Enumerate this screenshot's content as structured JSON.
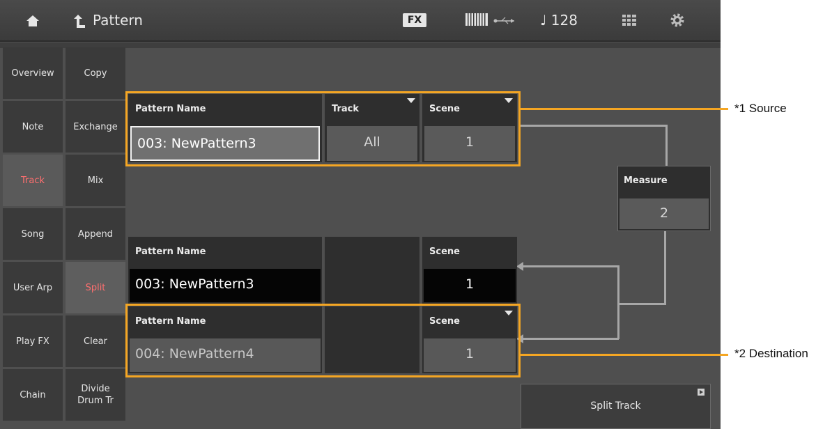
{
  "header": {
    "breadcrumb": "Pattern",
    "fx_label": "FX",
    "tempo": "♩ 128"
  },
  "sidebar": {
    "left": [
      {
        "label": "Overview"
      },
      {
        "label": "Note"
      },
      {
        "label": "Track"
      },
      {
        "label": "Song"
      },
      {
        "label": "User Arp"
      },
      {
        "label": "Play FX"
      },
      {
        "label": "Chain"
      }
    ],
    "right": [
      {
        "label": "Copy"
      },
      {
        "label": "Exchange"
      },
      {
        "label": "Mix"
      },
      {
        "label": "Append"
      },
      {
        "label": "Split"
      },
      {
        "label": "Clear"
      },
      {
        "label": "Divide\nDrum Tr"
      }
    ],
    "selected_left": "Track",
    "selected_right": "Split"
  },
  "source": {
    "pattern_name_header": "Pattern Name",
    "pattern_name_value": "003: NewPattern3",
    "track_header": "Track",
    "track_value": "All",
    "scene_header": "Scene",
    "scene_value": "1"
  },
  "measure": {
    "header": "Measure",
    "value": "2"
  },
  "result": {
    "pattern_name_header": "Pattern Name",
    "pattern_name_value": "003: NewPattern3",
    "scene_header": "Scene",
    "scene_value": "1"
  },
  "destination": {
    "pattern_name_header": "Pattern Name",
    "pattern_name_value": "004: NewPattern4",
    "scene_header": "Scene",
    "scene_value": "1"
  },
  "action": {
    "split_track_label": "Split Track"
  },
  "callouts": {
    "source": "*1 Source",
    "destination": "*2 Destination"
  },
  "colors": {
    "accent_orange": "#f5a623",
    "selected_text": "#ff6f6f",
    "background": "#4f4f4f"
  }
}
